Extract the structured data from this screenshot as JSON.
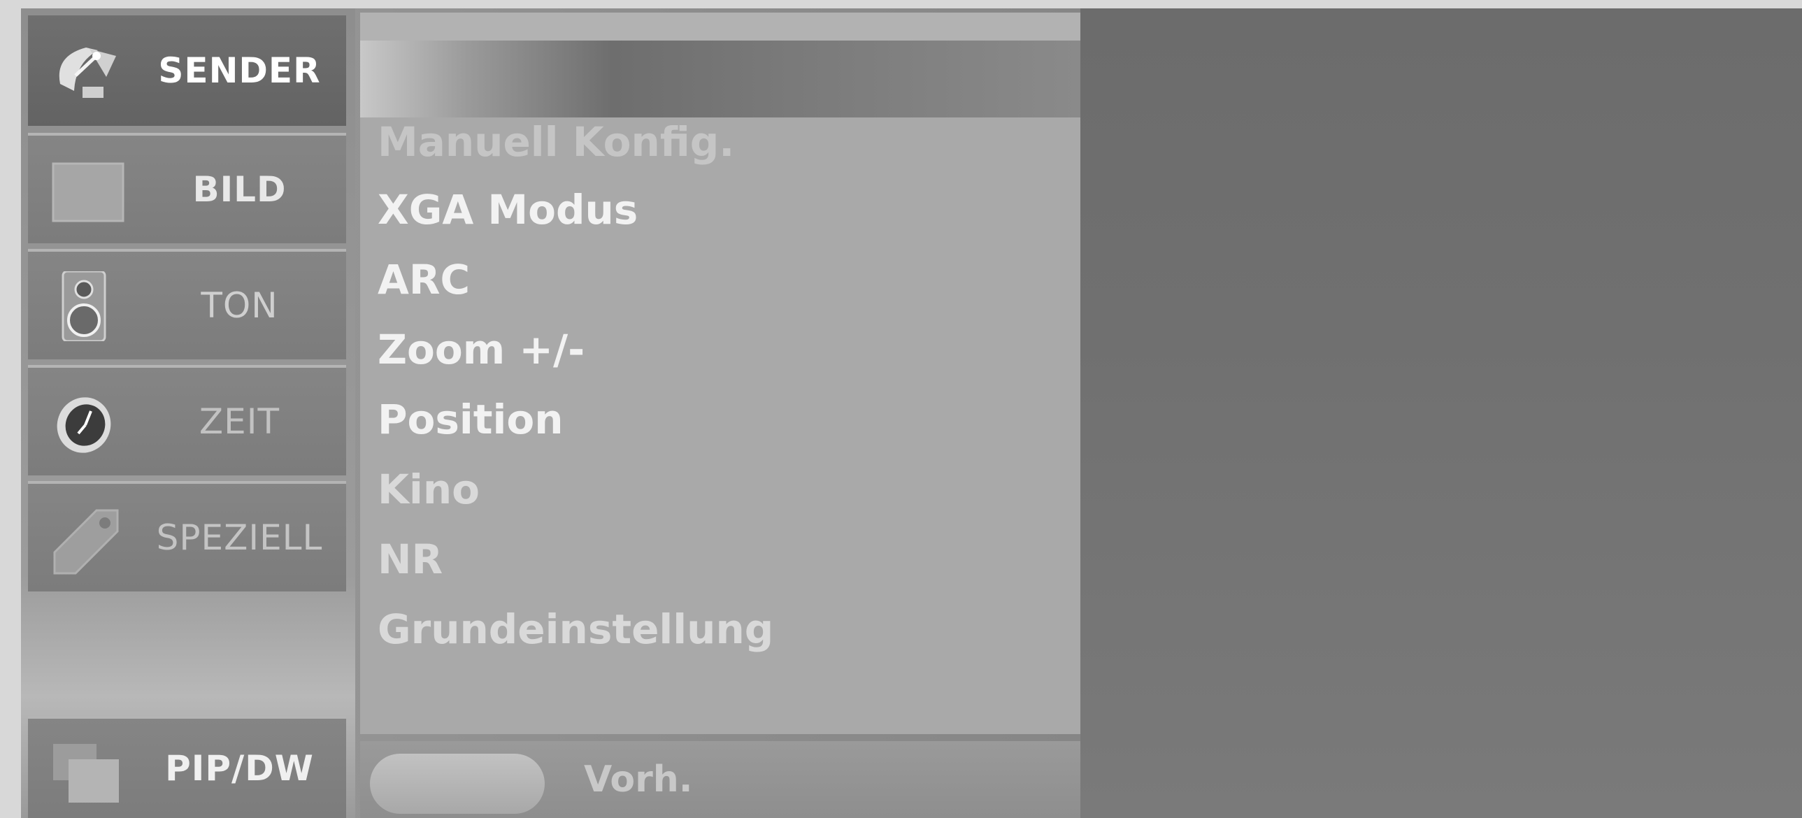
{
  "sidebar": {
    "items": [
      {
        "label": "SENDER",
        "icon": "satellite-dish-icon",
        "active": true
      },
      {
        "label": "BILD",
        "icon": "picture-square-icon",
        "active": false
      },
      {
        "label": "TON",
        "icon": "speaker-icon",
        "active": false
      },
      {
        "label": "ZEIT",
        "icon": "clock-icon",
        "active": false
      },
      {
        "label": "SPEZIELL",
        "icon": "tag-icon",
        "active": false
      }
    ],
    "bottom_item": {
      "label": "PIP/DW",
      "icon": "pip-windows-icon"
    }
  },
  "menu": {
    "items": [
      "Manuell Konfig.",
      "XGA Modus",
      "ARC",
      "Zoom +/-",
      "Position",
      "Kino",
      "NR",
      "Grundeinstellung"
    ]
  },
  "footer": {
    "prev_label": "Vorh."
  },
  "colors": {
    "active_label": "#ffffff",
    "inactive_label": "#d0d0d0",
    "menu_text": "#f2f2f2"
  }
}
